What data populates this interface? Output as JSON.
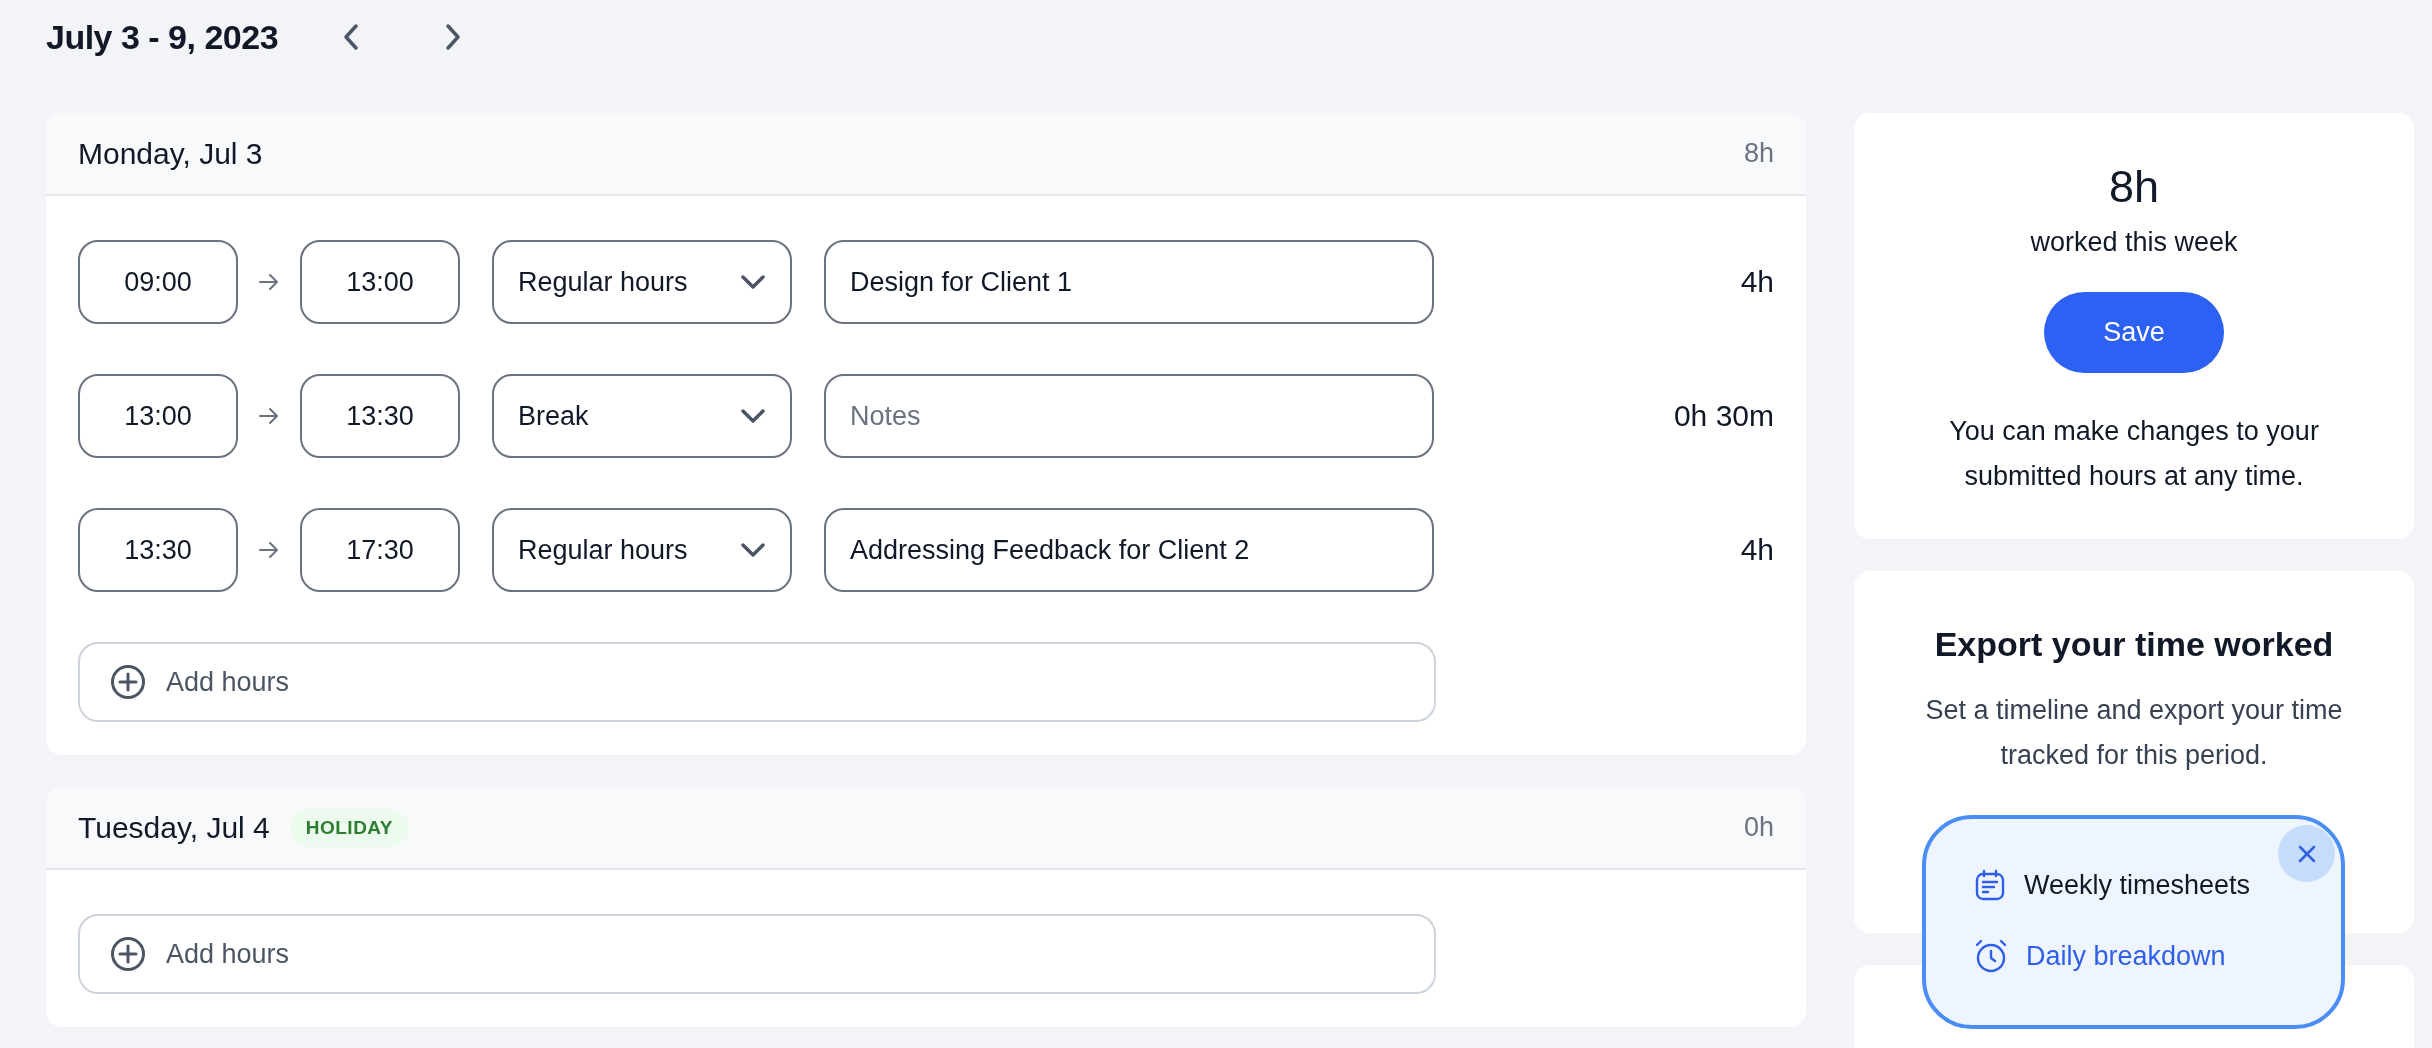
{
  "header": {
    "title": "July 3 - 9, 2023"
  },
  "days": [
    {
      "title": "Monday, Jul 3",
      "total": "8h",
      "entries": [
        {
          "start": "09:00",
          "end": "13:00",
          "type": "Regular hours",
          "note": "Design for Client 1",
          "duration": "4h"
        },
        {
          "start": "13:00",
          "end": "13:30",
          "type": "Break",
          "placeholder": "Notes",
          "duration": "0h 30m"
        },
        {
          "start": "13:30",
          "end": "17:30",
          "type": "Regular hours",
          "note": "Addressing Feedback for Client 2",
          "duration": "4h"
        }
      ],
      "add_label": "Add hours"
    },
    {
      "title": "Tuesday, Jul 4",
      "badge": "HOLIDAY",
      "total": "0h",
      "add_label": "Add hours"
    }
  ],
  "summary": {
    "total": "8h",
    "caption": "worked this week",
    "button": "Save",
    "note": "You can make changes to your submitted hours at any time."
  },
  "export": {
    "title": "Export your time worked",
    "description": "Set a timeline and export your time tracked for this period.",
    "menu": [
      {
        "kind": "calendar",
        "label": "Weekly timesheets",
        "selected": false
      },
      {
        "kind": "clock",
        "label": "Daily breakdown",
        "selected": true
      }
    ]
  }
}
